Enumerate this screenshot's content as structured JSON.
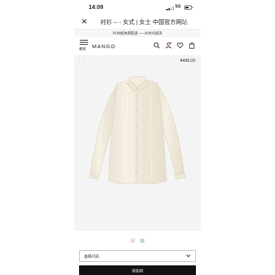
{
  "status_bar": {
    "time": "14:09",
    "network": "5G",
    "battery_level": 0.55
  },
  "browser": {
    "title": "衬衫 -- - 女式 | 女士 中国官方网站"
  },
  "promo": {
    "text": "¥199起免费配送——30天内退货"
  },
  "header": {
    "menu_label": "菜单",
    "brand": "MANGO",
    "icons": [
      "search-icon",
      "user-icon",
      "heart-icon",
      "bag-icon"
    ]
  },
  "product": {
    "price": "¥499.00",
    "image_desc": "cream satin long-sleeve shirt",
    "gallery_dots": "• •",
    "colors": [
      "#f0d9dd",
      "#bfd8cf"
    ]
  },
  "size_select": {
    "label": "选择尺码"
  },
  "add_button": {
    "label": "添加到"
  }
}
